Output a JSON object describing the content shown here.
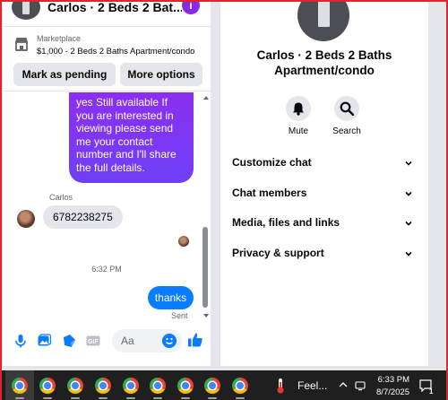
{
  "chat": {
    "header_title": "Carlos · 2 Beds 2 Bat...",
    "info_icon": "i",
    "marketplace_label": "Marketplace",
    "listing": "$1,000 - 2 Beds 2 Baths Apartment/condo",
    "mark_pending_label": "Mark as pending",
    "more_options_label": "More options",
    "messages": {
      "outgoing_1": "yes Still available If you are interested in viewing please send me your contact number and I'll share the full details.",
      "sender_name": "Carlos",
      "incoming_1": "6782238275",
      "timestamp": "6:32 PM",
      "outgoing_2": "thanks",
      "status": "Sent"
    },
    "composer": {
      "placeholder": "Aa",
      "icons": [
        "mic-icon",
        "photo-icon",
        "sticker-icon",
        "gif-icon",
        "emoji-icon",
        "like-icon"
      ],
      "gif_label": "GIF"
    }
  },
  "info": {
    "name": "Carlos · 2 Beds 2 Baths Apartment/condo",
    "actions": [
      {
        "label": "Mute",
        "icon": "bell-icon"
      },
      {
        "label": "Search",
        "icon": "search-icon"
      }
    ],
    "menu": [
      {
        "label": "Customize chat"
      },
      {
        "label": "Chat members"
      },
      {
        "label": "Media, files and links"
      },
      {
        "label": "Privacy & support"
      }
    ]
  },
  "taskbar": {
    "apps": [
      "chrome-icon",
      "chrome-icon",
      "chrome-icon",
      "chrome-icon",
      "chrome-icon",
      "chrome-icon",
      "chrome-icon",
      "chrome-icon",
      "chrome-icon"
    ],
    "weather_text": "Feel...",
    "time": "6:33 PM",
    "date": "8/7/2025",
    "notification_count": "1"
  },
  "colors": {
    "accent_blue": "#0a7cff",
    "bubble_purple": "#8b2ff0",
    "grey_bubble": "#e4e6eb",
    "taskbar": "#1f1f1f"
  }
}
